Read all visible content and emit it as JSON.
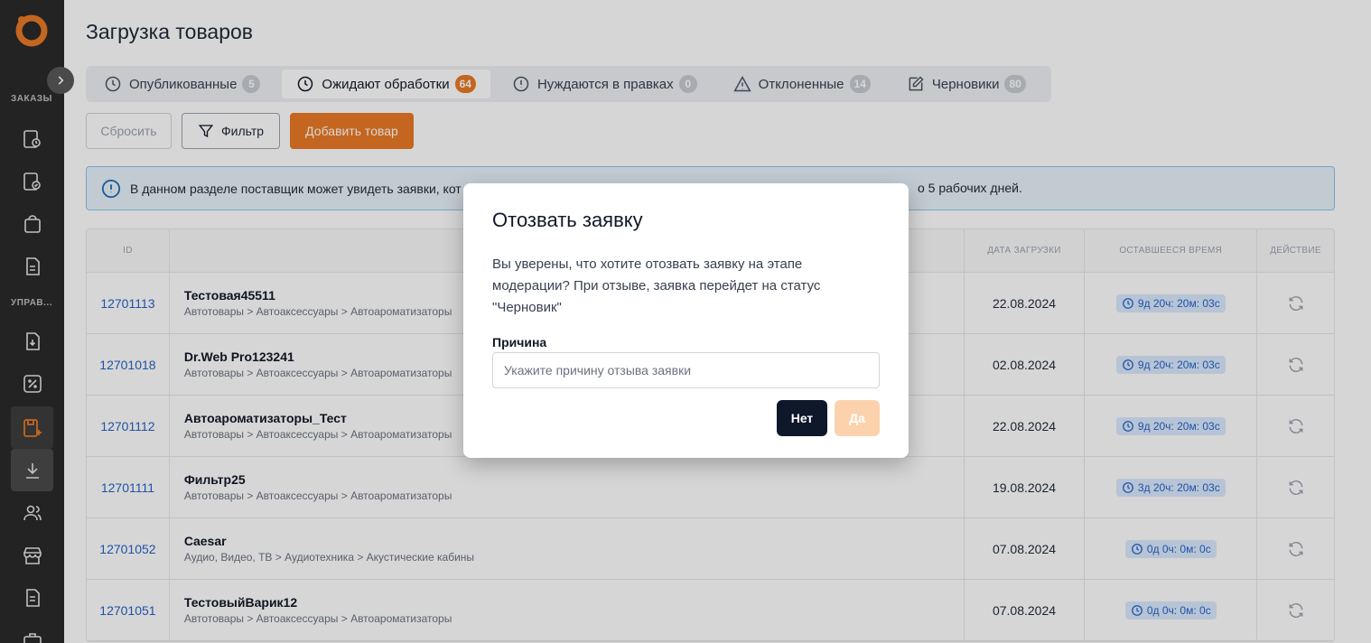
{
  "sidebar": {
    "section_orders": "ЗАКАЗЫ",
    "section_manage": "УПРАВ..."
  },
  "page": {
    "title": "Загрузка товаров"
  },
  "tabs": [
    {
      "label": "Опубликованные",
      "count": "5",
      "icon": "clock-icon"
    },
    {
      "label": "Ожидают обработки",
      "count": "64",
      "icon": "clock-icon",
      "active": true
    },
    {
      "label": "Нуждаются в правках",
      "count": "0",
      "icon": "alert-circle-icon"
    },
    {
      "label": "Отклоненные",
      "count": "14",
      "icon": "warning-triangle-icon"
    },
    {
      "label": "Черновики",
      "count": "80",
      "icon": "edit-icon"
    }
  ],
  "toolbar": {
    "reset_label": "Сбросить",
    "filter_label": "Фильтр",
    "add_label": "Добавить товар"
  },
  "banner": {
    "text_start": "В данном разделе поставщик может увидеть заявки, кот",
    "text_end": "о 5 рабочих дней."
  },
  "table": {
    "headers": {
      "id": "ID",
      "date": "ДАТА ЗАГРУЗКИ",
      "time": "ОСТАВШЕЕСЯ ВРЕМЯ",
      "action": "ДЕЙСТВИЕ"
    },
    "rows": [
      {
        "id": "12701113",
        "name": "Тестовая45511",
        "category": "Автотовары > Автоаксессуары > Автоароматизаторы",
        "date": "22.08.2024",
        "time": "9д 20ч: 20м: 03с"
      },
      {
        "id": "12701018",
        "name": "Dr.Web Pro123241",
        "category": "Автотовары > Автоаксессуары > Автоароматизаторы",
        "date": "02.08.2024",
        "time": "9д 20ч: 20м: 03с"
      },
      {
        "id": "12701112",
        "name": "Автоароматизаторы_Тест",
        "category": "Автотовары > Автоаксессуары > Автоароматизаторы",
        "date": "22.08.2024",
        "time": "9д 20ч: 20м: 03с"
      },
      {
        "id": "12701111",
        "name": "Фильтр25",
        "category": "Автотовары > Автоаксессуары > Автоароматизаторы",
        "date": "19.08.2024",
        "time": "3д 20ч: 20м: 03с"
      },
      {
        "id": "12701052",
        "name": "Caesar",
        "category": "Аудио, Видео, ТВ > Аудиотехника > Акустические кабины",
        "date": "07.08.2024",
        "time": "0д 0ч: 0м: 0с"
      },
      {
        "id": "12701051",
        "name": "ТестовыйВарик12",
        "category": "Автотовары > Автоаксессуары > Автоароматизаторы",
        "date": "07.08.2024",
        "time": "0д 0ч: 0м: 0с"
      }
    ]
  },
  "modal": {
    "title": "Отозвать заявку",
    "text": "Вы уверены, что хотите отозвать заявку на этапе модерации? При отзыве, заявка перейдет на статус \"Черновик\"",
    "field_label": "Причина",
    "field_placeholder": "Укажите причину отзыва заявки",
    "field_value": "",
    "no_label": "Нет",
    "yes_label": "Да"
  },
  "colors": {
    "accent": "#ea7a25",
    "sidebar_bg": "#2a2a2a",
    "link": "#2563c8",
    "modal_primary": "#0f172a"
  }
}
